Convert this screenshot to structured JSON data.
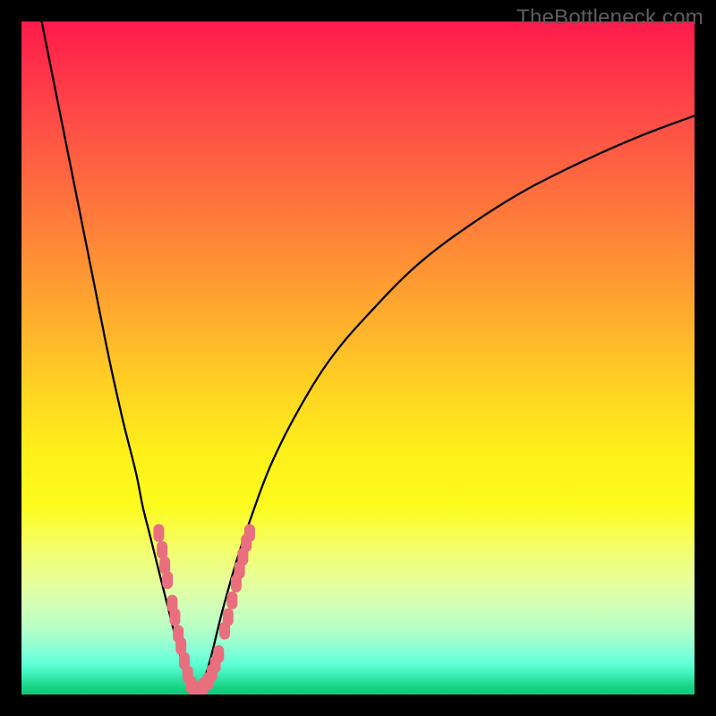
{
  "watermark": "TheBottleneck.com",
  "colors": {
    "frame": "#000000",
    "marker": "#e96f7e",
    "curve": "#000000"
  },
  "chart_data": {
    "type": "line",
    "title": "",
    "xlabel": "",
    "ylabel": "",
    "xlim": [
      0,
      100
    ],
    "ylim": [
      0,
      100
    ],
    "grid": false,
    "legend": false,
    "series": [
      {
        "name": "left-branch",
        "x": [
          3,
          5,
          7,
          9,
          11,
          13,
          15,
          17,
          18,
          19,
          20,
          21,
          22,
          23,
          23.8,
          24.5,
          25.2,
          25.8
        ],
        "y": [
          100,
          90,
          80,
          70,
          60,
          50,
          41,
          33,
          28,
          24,
          20,
          16,
          12,
          8,
          5,
          3,
          1.5,
          0.5
        ]
      },
      {
        "name": "right-branch",
        "x": [
          25.8,
          27,
          28,
          29,
          30,
          32,
          34,
          37,
          41,
          46,
          52,
          59,
          67,
          75,
          84,
          92,
          100
        ],
        "y": [
          0.5,
          2,
          5,
          9,
          13,
          20,
          26,
          34,
          42,
          50,
          57,
          64,
          70,
          75,
          79.5,
          83,
          86
        ]
      }
    ],
    "markers": {
      "name": "highlight-points",
      "points": [
        {
          "x": 20.4,
          "y": 24.0
        },
        {
          "x": 20.9,
          "y": 21.5
        },
        {
          "x": 21.3,
          "y": 19.2
        },
        {
          "x": 21.7,
          "y": 17.0
        },
        {
          "x": 22.4,
          "y": 13.5
        },
        {
          "x": 22.8,
          "y": 11.5
        },
        {
          "x": 23.3,
          "y": 9.0
        },
        {
          "x": 23.7,
          "y": 7.2
        },
        {
          "x": 24.2,
          "y": 5.0
        },
        {
          "x": 24.7,
          "y": 3.0
        },
        {
          "x": 25.2,
          "y": 1.5
        },
        {
          "x": 25.8,
          "y": 0.7
        },
        {
          "x": 26.4,
          "y": 0.7
        },
        {
          "x": 27.0,
          "y": 1.2
        },
        {
          "x": 27.7,
          "y": 2.0
        },
        {
          "x": 28.3,
          "y": 3.2
        },
        {
          "x": 28.8,
          "y": 4.5
        },
        {
          "x": 29.3,
          "y": 6.0
        },
        {
          "x": 30.2,
          "y": 9.5
        },
        {
          "x": 30.7,
          "y": 11.5
        },
        {
          "x": 31.3,
          "y": 14.0
        },
        {
          "x": 31.9,
          "y": 16.5
        },
        {
          "x": 32.4,
          "y": 18.5
        },
        {
          "x": 32.9,
          "y": 20.5
        },
        {
          "x": 33.4,
          "y": 22.5
        },
        {
          "x": 33.9,
          "y": 24.0
        }
      ]
    }
  }
}
